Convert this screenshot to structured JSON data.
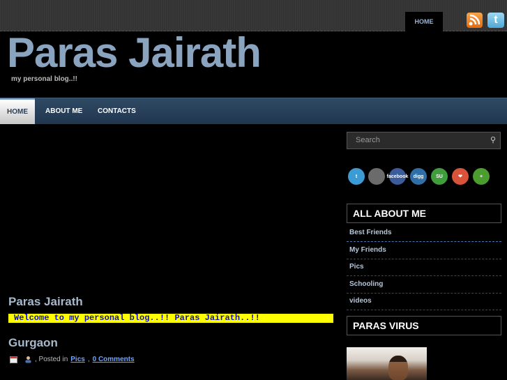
{
  "topbar": {
    "home_label": "HOME",
    "rss_icon": "rss-icon",
    "twitter_icon": "twitter-icon",
    "twitter_glyph": "t"
  },
  "header": {
    "title": "Paras Jairath",
    "tagline": "my personal blog..!!"
  },
  "nav": {
    "items": [
      {
        "label": "HOME"
      },
      {
        "label": "ABOUT ME"
      },
      {
        "label": "CONTACTS"
      }
    ]
  },
  "search": {
    "placeholder": "Search"
  },
  "social": [
    {
      "name": "twitter",
      "text": "t",
      "color": "#3d9bd4"
    },
    {
      "name": "delicious",
      "text": "",
      "color": "#6b6b6b"
    },
    {
      "name": "facebook",
      "text": "facebook",
      "color": "#3b5b9a"
    },
    {
      "name": "digg",
      "text": "digg",
      "color": "#2f6ea6"
    },
    {
      "name": "stumbleupon",
      "text": "SU",
      "color": "#3f9d3c"
    },
    {
      "name": "favorites",
      "text": "❤",
      "color": "#d9533a"
    },
    {
      "name": "addthis",
      "text": "+",
      "color": "#4b9d2f"
    }
  ],
  "sidebar": {
    "about_title": "ALL ABOUT ME",
    "links": [
      "Best Friends",
      "My Friends",
      "Pics",
      "Schooling",
      "videos"
    ],
    "virus_title": "PARAS VIRUS"
  },
  "posts": {
    "first_title": "Paras Jairath",
    "welcome": "Welcome to my personal blog..!! Paras Jairath..!!",
    "second_title": "Gurgaon",
    "meta_prefix": ", Posted in",
    "category": "Pics",
    "comments": "0 Comments"
  }
}
